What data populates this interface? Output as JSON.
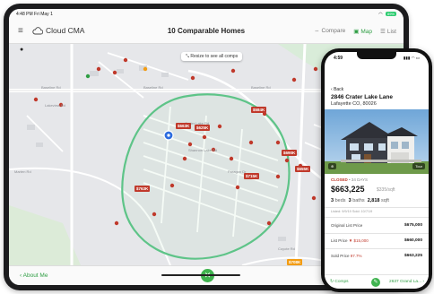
{
  "ipad": {
    "status": {
      "time_date": "4:48 PM  Fri May 1",
      "battery": "89%"
    },
    "header": {
      "brand": "Cloud CMA",
      "title": "10 Comparable Homes",
      "tools": {
        "compare": "Compare",
        "map": "Map",
        "list": "List"
      }
    },
    "map": {
      "resize_label": "Resize to see all comps",
      "road_labels": [
        "Baseline Rd",
        "Baseline Rd",
        "Baseline Rd",
        "Baseline Rd",
        "Lakeview Rd",
        "Shannon Lake Rd",
        "Crater Lake Rd",
        "Paragon Dr",
        "Emma St",
        "Marten Rd",
        "Main Stage Rd",
        "Coyote Rd"
      ],
      "price_tags": [
        {
          "label": "$663K",
          "color": "#c0392b"
        },
        {
          "label": "$625K",
          "color": "#c0392b"
        },
        {
          "label": "$584K",
          "color": "#c0392b"
        },
        {
          "label": "$690K",
          "color": "#c0392b"
        },
        {
          "label": "$655K",
          "color": "#c0392b"
        },
        {
          "label": "$715K",
          "color": "#c0392b"
        },
        {
          "label": "$763K",
          "color": "#c0392b"
        },
        {
          "label": "$708K",
          "color": "#f39c12"
        }
      ]
    },
    "footer": {
      "about": "About Me"
    }
  },
  "phone": {
    "status": {
      "time": "4:59",
      "signal": "▮▮▮ ◠ ▭"
    },
    "back": "Back",
    "address_line1": "2846 Crater Lake Lane",
    "address_line2": "Lafayette CO, 80026",
    "photo_buttons": {
      "map": "⊕",
      "tour": "Tour"
    },
    "listing": {
      "status": "CLOSED",
      "days": "• 34 DAYS",
      "price": "$663,225",
      "per_sqft": "$335/sqft",
      "beds": "3",
      "beds_label": "beds",
      "baths": "3",
      "baths_label": "baths",
      "sqft": "2,818",
      "sqft_label": "sqft",
      "listed_sold": "Listed: 9/9/19   Sold: 10/7/19",
      "rows": [
        {
          "label": "Original List Price",
          "extra": "",
          "value": "$675,000"
        },
        {
          "label": "List Price",
          "extra": "▼ $15,000",
          "value": "$660,000"
        },
        {
          "label": "Sold Price",
          "extra": "97.7%",
          "value": "$663,225"
        }
      ]
    },
    "footer": {
      "comps": "Comps",
      "next": "2637 Grand La..."
    }
  },
  "colors": {
    "accent": "#3fb34f",
    "price_tag": "#c0392b",
    "closed": "#c0392b"
  },
  "icons": [
    "menu-icon",
    "cloud-icon",
    "compare-icon",
    "map-icon",
    "list-icon",
    "info-icon",
    "resize-icon",
    "chevron-left-icon",
    "close-icon",
    "pin-icon"
  ]
}
